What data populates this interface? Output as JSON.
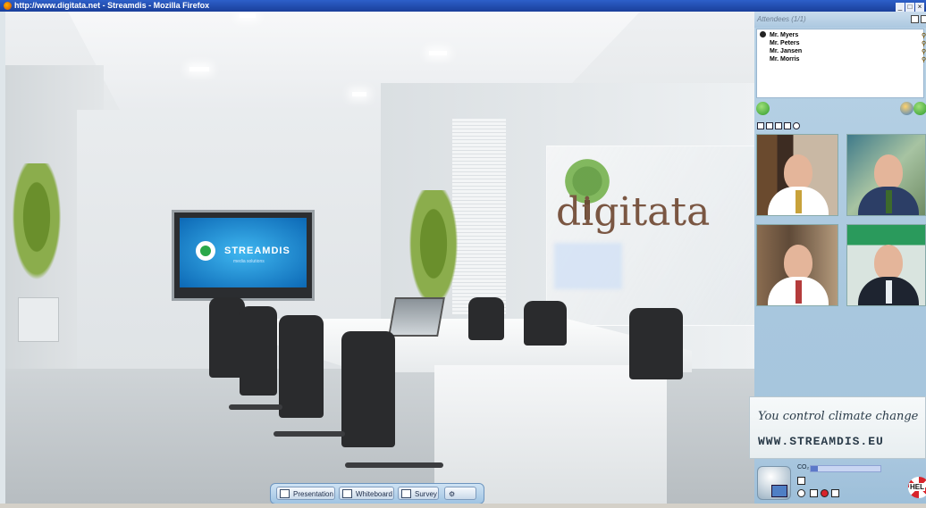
{
  "window": {
    "title": "http://www.digitata.net - Streamdis - Mozilla Firefox",
    "controls": [
      "_",
      "□",
      "×"
    ]
  },
  "scene": {
    "tv_brand": "STREAMDIS",
    "tv_subtitle": "media solutions",
    "wall_logo": "digitata"
  },
  "toolbar": {
    "presentation_label": "Presentation",
    "whiteboard_label": "Whiteboard",
    "survey_label": "Survey"
  },
  "attendees": {
    "header": "Attendees (1/1)",
    "list": [
      {
        "name": "Mr. Myers"
      },
      {
        "name": "Mr. Peters"
      },
      {
        "name": "Mr. Jansen"
      },
      {
        "name": "Mr. Morris"
      }
    ]
  },
  "banner": {
    "line1": "You control climate change",
    "line2": "WWW.STREAMDIS.EU"
  },
  "bottom": {
    "co2_label": "CO₂",
    "co2_level": 0.1,
    "help_label": "HEL"
  },
  "colors": {
    "accent": "#2d5fc9",
    "panel_bg": "#b9d3e6",
    "call_green": "#3aa83a"
  }
}
